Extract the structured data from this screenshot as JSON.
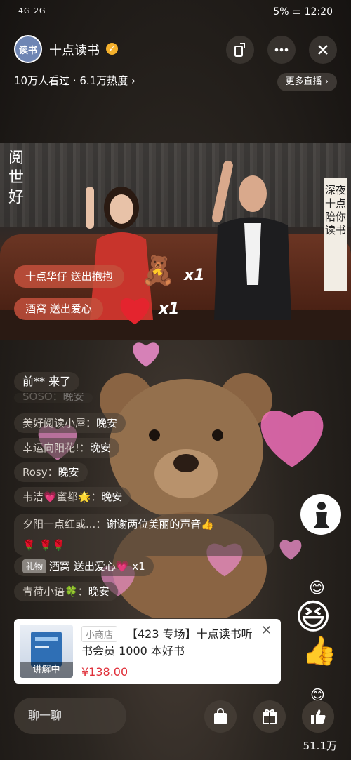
{
  "status_bar": {
    "left": "4G 2G",
    "battery": "5%",
    "time": "12:20"
  },
  "header": {
    "avatar_text": "读书",
    "channel_name": "十点读书",
    "stats": "10万人看过 · 6.1万热度 ›",
    "more_live": "更多直播 ›"
  },
  "video": {
    "title_art": "阅世好",
    "banner": "深夜十点 陪你读书"
  },
  "gifts": [
    {
      "text": "十点华仔 送出抱抱",
      "count": "x1"
    },
    {
      "text": "酒窝 送出爱心",
      "count": "x1"
    }
  ],
  "chat": {
    "join": "前** 来了",
    "messages": [
      {
        "user": "SOSO：",
        "text": "晚安"
      },
      {
        "user": "美好阅读小屋：",
        "text": "晚安"
      },
      {
        "user": "幸运向阳花!：",
        "text": "晚安"
      },
      {
        "user": "Rosy：",
        "text": "晚安"
      },
      {
        "user": "韦洁💗蜜都🌟：",
        "text": "晚安"
      },
      {
        "user": "夕阳一点红或...：",
        "text": "谢谢两位美丽的声音👍"
      },
      {
        "user": "",
        "text": "🌹 🌹🌹"
      },
      {
        "tag": "礼物",
        "user": "酒窝",
        "text": "送出爱心💗 x1"
      },
      {
        "user": "青荷小语🍀：",
        "text": "晚安"
      }
    ]
  },
  "product": {
    "shop": "小商店",
    "title": "【423 专场】十点读书听书会员 1000 本好书",
    "price": "¥138.00",
    "thumb_badge": "讲解中",
    "close": "✕"
  },
  "bottom": {
    "comment_placeholder": "聊一聊",
    "likes": "51.1万"
  },
  "colors": {
    "accent": "#e0303a",
    "gift_bg": "#c4503c",
    "verify": "#f5b12c"
  }
}
